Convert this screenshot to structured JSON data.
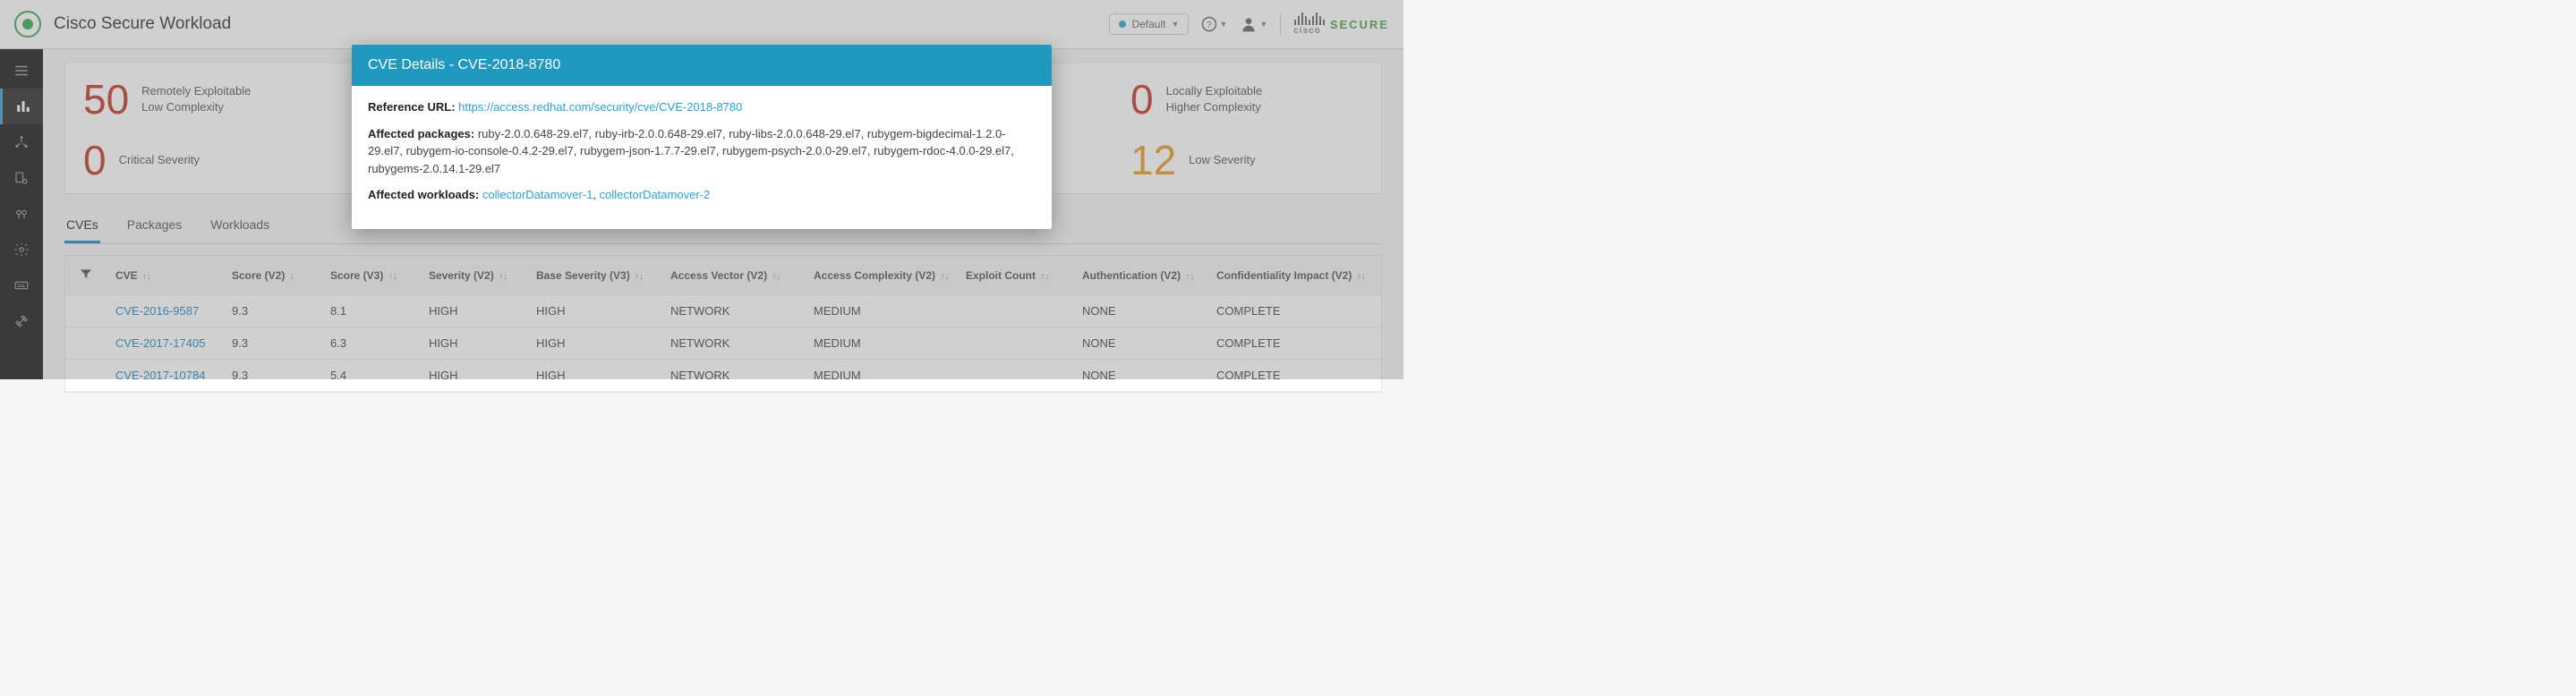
{
  "header": {
    "title": "Cisco Secure Workload",
    "scope_label": "Default",
    "secure_label": "SECURE",
    "cisco_label": "cisco"
  },
  "stats": [
    {
      "value": "50",
      "label1": "Remotely Exploitable",
      "label2": "Low Complexity",
      "color": "c-red"
    },
    {
      "value": "0",
      "label1": "Locally Exploitable",
      "label2": "Higher Complexity",
      "color": "c-red"
    },
    {
      "value": "0",
      "label1": "Critical Severity",
      "label2": "",
      "color": "c-red"
    },
    {
      "value": "12",
      "label1": "Low Severity",
      "label2": "",
      "color": "c-orange"
    }
  ],
  "tabs": [
    {
      "label": "CVEs",
      "active": true
    },
    {
      "label": "Packages",
      "active": false
    },
    {
      "label": "Workloads",
      "active": false
    }
  ],
  "table": {
    "columns": [
      "CVE",
      "Score (V2)",
      "Score (V3)",
      "Severity (V2)",
      "Base Severity (V3)",
      "Access Vector (V2)",
      "Access Complexity (V2)",
      "Exploit Count",
      "Authentication (V2)",
      "Confidentiality Impact (V2)"
    ],
    "sort_indicators": [
      "↑↓",
      "↓",
      "↑↓",
      "↑↓",
      "↑↓",
      "↑↓",
      "↑↓",
      "↑↓",
      "↑↓",
      "↑↓"
    ],
    "rows": [
      {
        "cve": "CVE-2016-9587",
        "v2": "9.3",
        "v3": "8.1",
        "sev2": "HIGH",
        "sev3": "HIGH",
        "av": "NETWORK",
        "ac": "MEDIUM",
        "ec": "",
        "auth": "NONE",
        "ci": "COMPLETE"
      },
      {
        "cve": "CVE-2017-17405",
        "v2": "9.3",
        "v3": "6.3",
        "sev2": "HIGH",
        "sev3": "HIGH",
        "av": "NETWORK",
        "ac": "MEDIUM",
        "ec": "",
        "auth": "NONE",
        "ci": "COMPLETE"
      },
      {
        "cve": "CVE-2017-10784",
        "v2": "9.3",
        "v3": "5.4",
        "sev2": "HIGH",
        "sev3": "HIGH",
        "av": "NETWORK",
        "ac": "MEDIUM",
        "ec": "",
        "auth": "NONE",
        "ci": "COMPLETE"
      }
    ]
  },
  "modal": {
    "title": "CVE Details - CVE-2018-8780",
    "ref_label": "Reference URL:",
    "ref_url": "https://access.redhat.com/security/cve/CVE-2018-8780",
    "pkg_label": "Affected packages:",
    "pkg_text": "ruby-2.0.0.648-29.el7, ruby-irb-2.0.0.648-29.el7, ruby-libs-2.0.0.648-29.el7, rubygem-bigdecimal-1.2.0-29.el7, rubygem-io-console-0.4.2-29.el7, rubygem-json-1.7.7-29.el7, rubygem-psych-2.0.0-29.el7, rubygem-rdoc-4.0.0-29.el7, rubygems-2.0.14.1-29.el7",
    "wl_label": "Affected workloads:",
    "wl_1": "collectorDatamover-1",
    "wl_sep": ", ",
    "wl_2": "collectorDatamover-2"
  }
}
